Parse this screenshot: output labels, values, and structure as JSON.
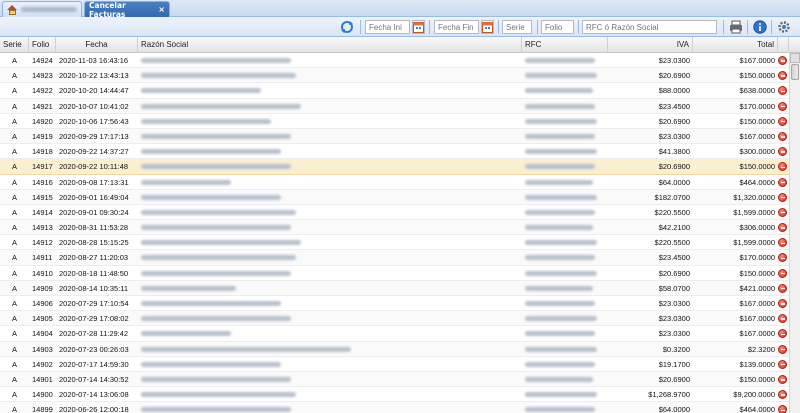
{
  "tabs": {
    "home_blurred": true,
    "active_label": "Cancelar Facturas",
    "close_symbol": "×"
  },
  "toolbar": {
    "fecha_ini_placeholder": "Fecha Ini",
    "fecha_fin_placeholder": "Fecha Fin",
    "serie_placeholder": "Serie",
    "folio_placeholder": "Folio",
    "search_placeholder": "RFC ó Razón Social"
  },
  "columns": [
    "Serie",
    "Folio",
    "Fecha",
    "Razón Social",
    "RFC",
    "IVA",
    "Total"
  ],
  "rows": [
    {
      "serie": "A",
      "folio": "14924",
      "fecha": "2020-11-03 16:43:16",
      "iva": "$23.0300",
      "total": "$167.0000"
    },
    {
      "serie": "A",
      "folio": "14923",
      "fecha": "2020-10-22 13:43:13",
      "iva": "$20.6900",
      "total": "$150.0000"
    },
    {
      "serie": "A",
      "folio": "14922",
      "fecha": "2020-10-20 14:44:47",
      "iva": "$88.0000",
      "total": "$638.0000"
    },
    {
      "serie": "A",
      "folio": "14921",
      "fecha": "2020-10-07 10:41:02",
      "iva": "$23.4500",
      "total": "$170.0000"
    },
    {
      "serie": "A",
      "folio": "14920",
      "fecha": "2020-10-06 17:56:43",
      "iva": "$20.6900",
      "total": "$150.0000"
    },
    {
      "serie": "A",
      "folio": "14919",
      "fecha": "2020-09-29 17:17:13",
      "iva": "$23.0300",
      "total": "$167.0000"
    },
    {
      "serie": "A",
      "folio": "14918",
      "fecha": "2020-09-22 14:37:27",
      "iva": "$41.3800",
      "total": "$300.0000"
    },
    {
      "serie": "A",
      "folio": "14917",
      "fecha": "2020-09-22 10:11:48",
      "iva": "$20.6900",
      "total": "$150.0000",
      "selected": true
    },
    {
      "serie": "A",
      "folio": "14916",
      "fecha": "2020-09-08 17:13:31",
      "iva": "$64.0000",
      "total": "$464.0000"
    },
    {
      "serie": "A",
      "folio": "14915",
      "fecha": "2020-09-01 16:49:04",
      "iva": "$182.0700",
      "total": "$1,320.0000"
    },
    {
      "serie": "A",
      "folio": "14914",
      "fecha": "2020-09-01 09:30:24",
      "iva": "$220.5500",
      "total": "$1,599.0000"
    },
    {
      "serie": "A",
      "folio": "14913",
      "fecha": "2020-08-31 11:53:28",
      "iva": "$42.2100",
      "total": "$306.0000"
    },
    {
      "serie": "A",
      "folio": "14912",
      "fecha": "2020-08-28 15:15:25",
      "iva": "$220.5500",
      "total": "$1,599.0000"
    },
    {
      "serie": "A",
      "folio": "14911",
      "fecha": "2020-08-27 11:20:03",
      "iva": "$23.4500",
      "total": "$170.0000"
    },
    {
      "serie": "A",
      "folio": "14910",
      "fecha": "2020-08-18 11:48:50",
      "iva": "$20.6900",
      "total": "$150.0000"
    },
    {
      "serie": "A",
      "folio": "14909",
      "fecha": "2020-08-14 10:35:11",
      "iva": "$58.0700",
      "total": "$421.0000"
    },
    {
      "serie": "A",
      "folio": "14906",
      "fecha": "2020-07-29 17:10:54",
      "iva": "$23.0300",
      "total": "$167.0000"
    },
    {
      "serie": "A",
      "folio": "14905",
      "fecha": "2020-07-29 17:08:02",
      "iva": "$23.0300",
      "total": "$167.0000"
    },
    {
      "serie": "A",
      "folio": "14904",
      "fecha": "2020-07-28 11:29:42",
      "iva": "$23.0300",
      "total": "$167.0000"
    },
    {
      "serie": "A",
      "folio": "14903",
      "fecha": "2020-07-23 00:26:03",
      "iva": "$0.3200",
      "total": "$2.3200"
    },
    {
      "serie": "A",
      "folio": "14902",
      "fecha": "2020-07-17 14:59:30",
      "iva": "$19.1700",
      "total": "$139.0000"
    },
    {
      "serie": "A",
      "folio": "14901",
      "fecha": "2020-07-14 14:30:52",
      "iva": "$20.6900",
      "total": "$150.0000"
    },
    {
      "serie": "A",
      "folio": "14900",
      "fecha": "2020-07-14 13:06:08",
      "iva": "$1,268.9700",
      "total": "$9,200.0000"
    },
    {
      "serie": "A",
      "folio": "14899",
      "fecha": "2020-06-26 12:00:18",
      "iva": "$64.0000",
      "total": "$464.0000"
    }
  ]
}
